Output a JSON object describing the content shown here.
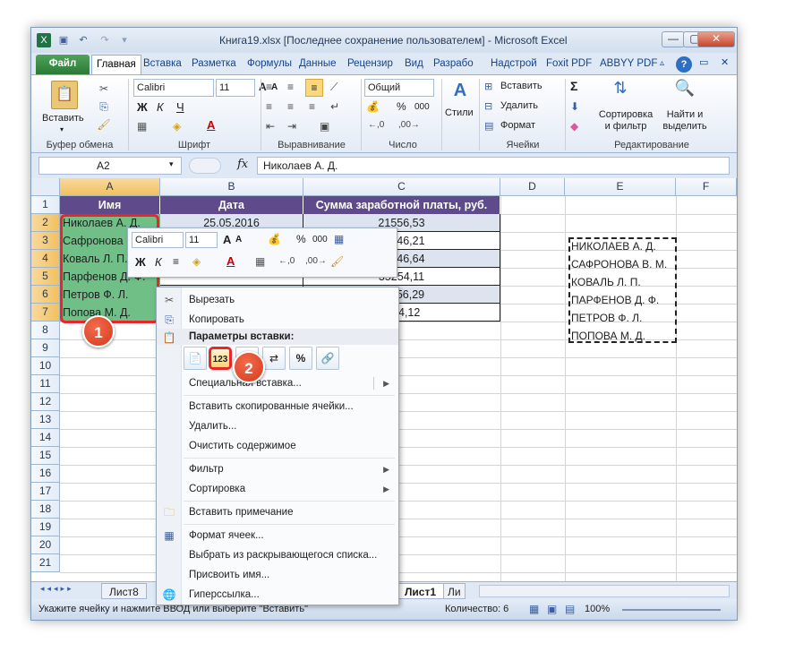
{
  "window": {
    "title": "Книга19.xlsx [Последнее сохранение пользователем]  -  Microsoft Excel",
    "controls": {
      "minimize": "—",
      "maximize": "▢",
      "close": "✕"
    }
  },
  "ribbon_tabs": [
    "Файл",
    "Главная",
    "Вставка",
    "Разметка",
    "Формулы",
    "Данные",
    "Рецензир",
    "Вид",
    "Разрабо",
    "Надстрой",
    "Foxit PDF",
    "ABBYY PDF"
  ],
  "ribbon": {
    "clipboard": {
      "paste": "Вставить",
      "label": "Буфер обмена"
    },
    "font": {
      "name": "Calibri",
      "size": "11",
      "label": "Шрифт",
      "bold": "Ж",
      "italic": "К",
      "underline": "Ч"
    },
    "alignment": {
      "label": "Выравнивание"
    },
    "number": {
      "format": "Общий",
      "label": "Число",
      "percent": "%",
      "thousands": "000"
    },
    "styles": {
      "label": "Стили"
    },
    "cells": {
      "insert": "Вставить",
      "delete": "Удалить",
      "format": "Формат",
      "label": "Ячейки"
    },
    "editing": {
      "sort": "Сортировка\nи фильтр",
      "sort_l1": "Сортировка",
      "sort_l2": "и фильтр",
      "find_l1": "Найти и",
      "find_l2": "выделить",
      "label": "Редактирование",
      "sigma": "Σ"
    }
  },
  "formula_bar": {
    "name_box": "A2",
    "fx": "fx",
    "value": "Николаев А. Д."
  },
  "columns": [
    "A",
    "B",
    "C",
    "D",
    "E",
    "F"
  ],
  "rows": [
    "1",
    "2",
    "3",
    "4",
    "5",
    "6",
    "7",
    "8",
    "9",
    "10",
    "11",
    "12",
    "13",
    "14",
    "15",
    "16",
    "17",
    "18",
    "19",
    "20",
    "21"
  ],
  "table": {
    "headers": [
      "Имя",
      "Дата",
      "Сумма заработной платы, руб."
    ],
    "names": [
      "Николаев А. Д.",
      "Сафронова В. М.",
      "Коваль Л. П.",
      "Парфенов Д. Ф.",
      "Петров Ф. Л.",
      "Попова М. Д."
    ],
    "dates": [
      "25.05.2016",
      "",
      "",
      "",
      "",
      ""
    ],
    "sums": [
      "21556,53",
      "18546,21",
      "10546,64",
      "35254,11",
      "11556,29",
      "...54,12"
    ]
  },
  "column_e": [
    "НИКОЛАЕВ А. Д.",
    "САФРОНОВА В. М.",
    "КОВАЛЬ Л. П.",
    "ПАРФЕНОВ Д. Ф.",
    "ПЕТРОВ Ф. Л.",
    "ПОПОВА М. Д."
  ],
  "minibar": {
    "font": "Calibri",
    "size": "11",
    "percent": "%",
    "thousands": "000",
    "bold": "Ж",
    "italic": "К"
  },
  "context_menu": {
    "cut": "Вырезать",
    "copy": "Копировать",
    "paste_options_header": "Параметры вставки:",
    "paste_special": "Специальная вставка...",
    "insert_copied": "Вставить скопированные ячейки...",
    "delete": "Удалить...",
    "clear": "Очистить содержимое",
    "filter": "Фильтр",
    "sort": "Сортировка",
    "insert_comment": "Вставить примечание",
    "format_cells": "Формат ячеек...",
    "pick_list": "Выбрать из раскрывающегося списка...",
    "define_name": "Присвоить имя...",
    "hyperlink": "Гиперссылка..."
  },
  "sheets": {
    "first": "Лист8",
    "active": "Лист1",
    "next": "Ли"
  },
  "status": {
    "message": "Укажите ячейку и нажмите ВВОД или выберите \"Вставить\"",
    "count": "Количество: 6",
    "zoom": "100%"
  },
  "badges": {
    "one": "1",
    "two": "2"
  },
  "colors": {
    "header_purple": "#5f4b8b",
    "name_green": "#6fbf87",
    "row_lilac": "#dde4f0",
    "highlight_red": "#e8262b",
    "file_tab": "#2a7a36"
  }
}
